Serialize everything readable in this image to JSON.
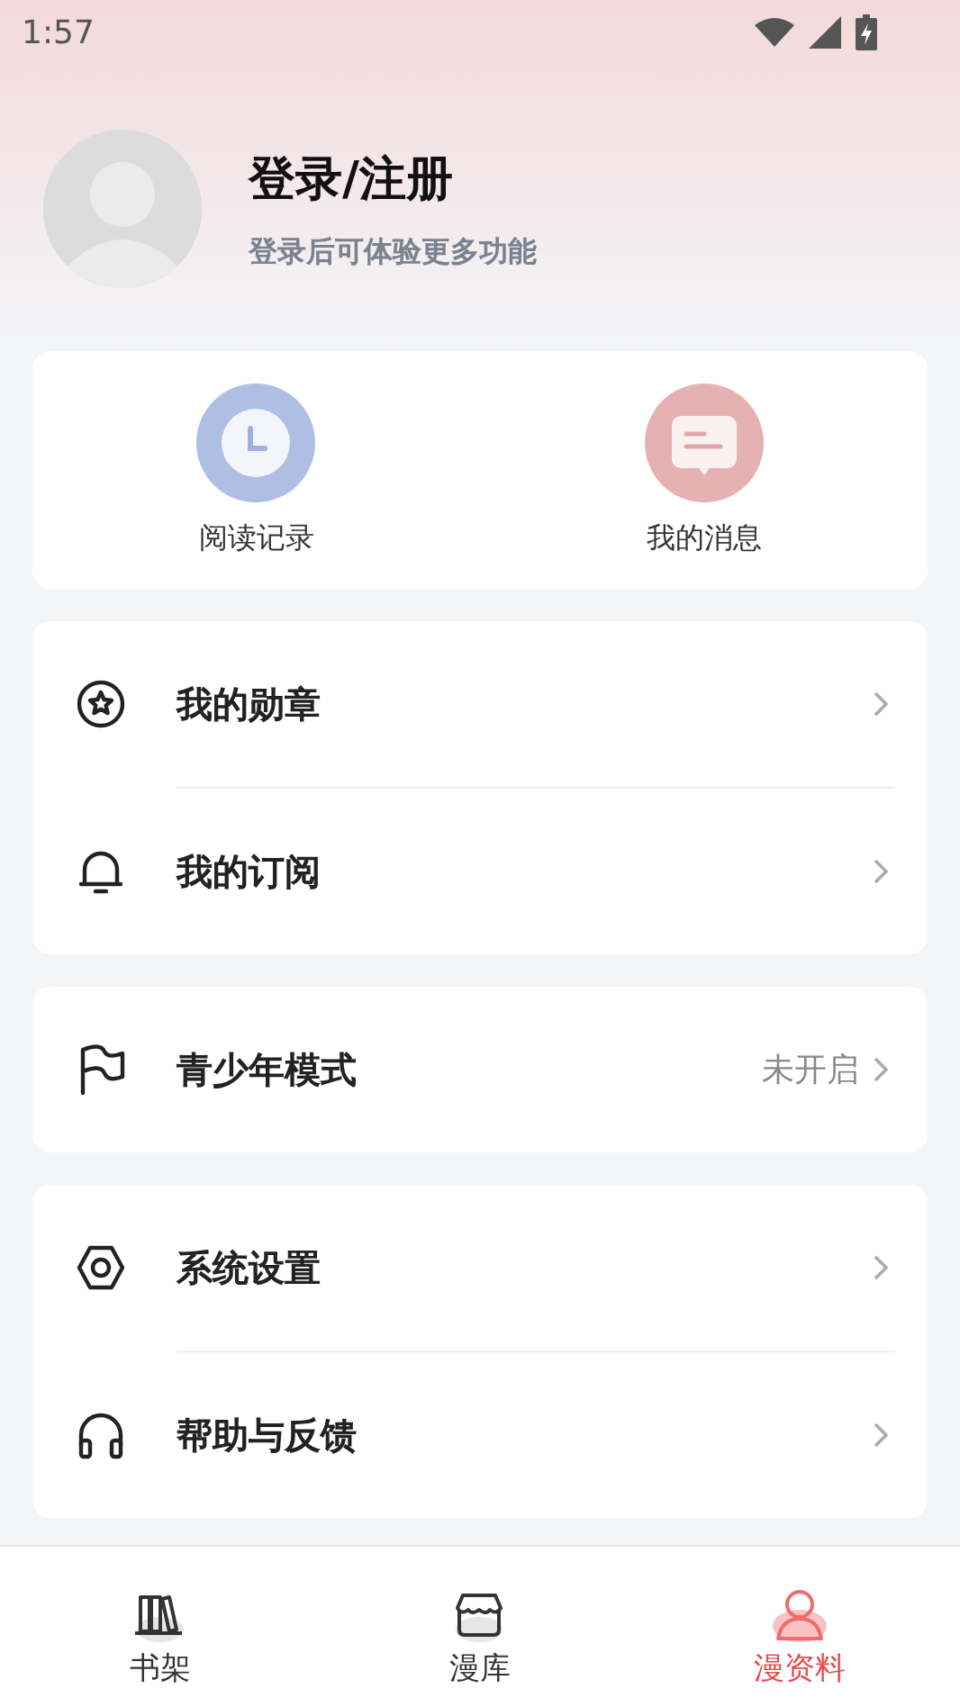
{
  "status_bar": {
    "time": "1:57"
  },
  "profile": {
    "title": "登录/注册",
    "subtitle": "登录后可体验更多功能"
  },
  "shortcuts": [
    {
      "kind": "history",
      "label": "阅读记录"
    },
    {
      "kind": "messages",
      "label": "我的消息"
    }
  ],
  "menu_groups": [
    [
      {
        "kind": "medal",
        "label": "我的勋章"
      },
      {
        "kind": "bell",
        "label": "我的订阅"
      }
    ],
    [
      {
        "kind": "flag",
        "label": "青少年模式",
        "value": "未开启"
      }
    ],
    [
      {
        "kind": "settings",
        "label": "系统设置"
      },
      {
        "kind": "headset",
        "label": "帮助与反馈"
      }
    ]
  ],
  "tabs": [
    {
      "kind": "shelf",
      "label": "书架",
      "selected": false
    },
    {
      "kind": "store",
      "label": "漫库",
      "selected": false
    },
    {
      "kind": "profile",
      "label": "漫资料",
      "selected": true
    }
  ]
}
